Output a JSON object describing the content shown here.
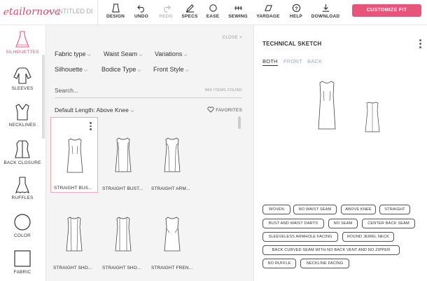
{
  "app": {
    "logo_text": "tailornova",
    "breadcrumb_sep": ">",
    "doc_title": "UNTITLED DES"
  },
  "toolbar": {
    "items": [
      {
        "label": "DESIGN",
        "icon": "design-icon"
      },
      {
        "label": "UNDO",
        "icon": "undo-icon"
      },
      {
        "label": "REDO",
        "icon": "redo-icon"
      },
      {
        "label": "SPECS",
        "icon": "pencil-icon"
      },
      {
        "label": "EASE",
        "icon": "circle-icon"
      },
      {
        "label": "SEWING",
        "icon": "sewing-icon"
      },
      {
        "label": "YARDAGE",
        "icon": "fabric-icon"
      },
      {
        "label": "HELP",
        "icon": "help-icon"
      },
      {
        "label": "DOWNLOAD",
        "icon": "download-icon"
      }
    ],
    "cta_label": "CUSTOMIZE FIT",
    "cta_color": "#e9557a"
  },
  "categories": [
    {
      "label": "SILHOUETTES",
      "active": true
    },
    {
      "label": "SLEEVES"
    },
    {
      "label": "NECKLINES"
    },
    {
      "label": "BACK CLOSURE"
    },
    {
      "label": "RUFFLES"
    },
    {
      "label": "COLOR"
    },
    {
      "label": "FABRIC"
    }
  ],
  "library": {
    "close_label": "CLOSE",
    "close_icon": "×",
    "filters": [
      "Fabric type",
      "Waist Seam",
      "Variations",
      "Silhouette",
      "Bodice Type",
      "Front Style"
    ],
    "search_placeholder": "Search...",
    "items_found": "864 ITEMS FOUND",
    "default_length": "Default Length: Above Knee",
    "favorites_label": "FAVORITES",
    "cards": [
      {
        "label": "STRAIGHT BUS..."
      },
      {
        "label": "STRAIGHT BUST..."
      },
      {
        "label": "STRAIGHT ARM..."
      },
      {
        "label": "STRAIGHT SHO..."
      },
      {
        "label": "STRAIGHT SHO..."
      },
      {
        "label": "STRAIGHT FREN..."
      }
    ]
  },
  "sketch": {
    "title": "TECHNICAL SKETCH",
    "tabs": [
      "BOTH",
      "FRONT",
      "BACK"
    ],
    "tags": [
      "WOVEN",
      "NO WAIST SEAM",
      "ABOVE KNEE",
      "STRAIGHT",
      "BUST AND WAIST DARTS",
      "NO SEAM",
      "CENTER BACK SEAM",
      "SLEEVELESS ARMHOLE FACING",
      "ROUND JEWEL NECK",
      "BACK CURVED SEAM WITH NO BACK VENT AND NO ZIPPER",
      "NO RUFFLE",
      "NECKLINE FACING"
    ]
  }
}
